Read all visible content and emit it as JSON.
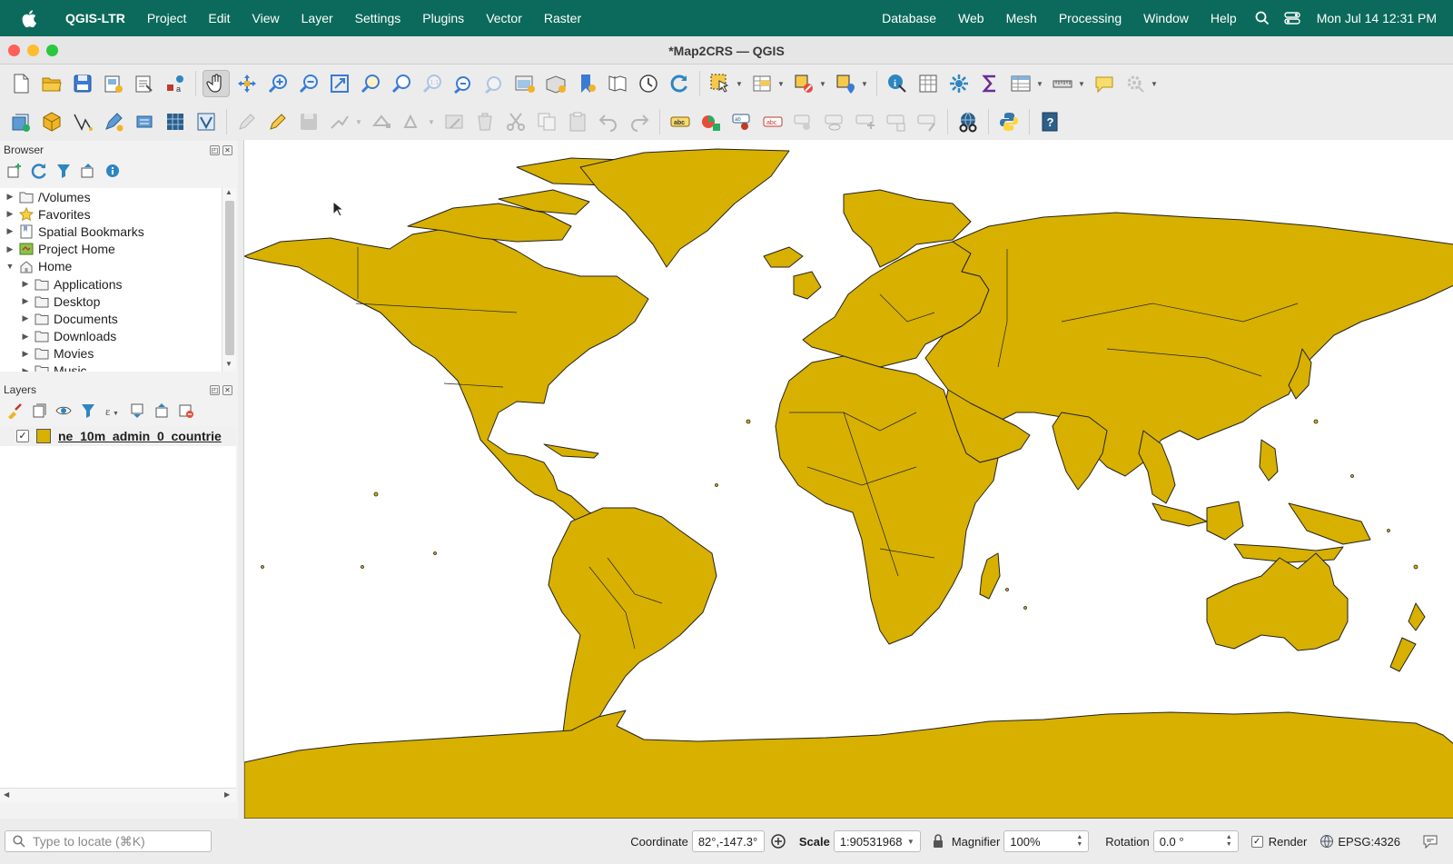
{
  "menubar": {
    "app_name": "QGIS-LTR",
    "left_items": [
      "Project",
      "Edit",
      "View",
      "Layer",
      "Settings",
      "Plugins",
      "Vector",
      "Raster"
    ],
    "right_items": [
      "Database",
      "Web",
      "Mesh",
      "Processing",
      "Window",
      "Help"
    ],
    "clock": "Mon Jul 14  12:31 PM"
  },
  "window": {
    "title": "*Map2CRS — QGIS"
  },
  "browser": {
    "title": "Browser",
    "items": [
      {
        "label": "/Volumes",
        "icon": "folder-icon",
        "indent": 0,
        "expanded": false
      },
      {
        "label": "Favorites",
        "icon": "star-icon",
        "indent": 0,
        "expanded": false
      },
      {
        "label": "Spatial Bookmarks",
        "icon": "bookmark-icon",
        "indent": 0,
        "expanded": false
      },
      {
        "label": "Project Home",
        "icon": "project-home-icon",
        "indent": 0,
        "expanded": false
      },
      {
        "label": "Home",
        "icon": "home-icon",
        "indent": 0,
        "expanded": true
      },
      {
        "label": "Applications",
        "icon": "folder-icon",
        "indent": 1,
        "expanded": false
      },
      {
        "label": "Desktop",
        "icon": "folder-icon",
        "indent": 1,
        "expanded": false
      },
      {
        "label": "Documents",
        "icon": "folder-icon",
        "indent": 1,
        "expanded": false
      },
      {
        "label": "Downloads",
        "icon": "folder-icon",
        "indent": 1,
        "expanded": false
      },
      {
        "label": "Movies",
        "icon": "folder-icon",
        "indent": 1,
        "expanded": false
      },
      {
        "label": "Music",
        "icon": "folder-icon",
        "indent": 1,
        "expanded": false
      }
    ]
  },
  "layers": {
    "title": "Layers",
    "items": [
      {
        "name": "ne_10m_admin_0_countrie",
        "checked": true,
        "fill_color": "#d7b000"
      }
    ]
  },
  "statusbar": {
    "locator_placeholder": "Type to locate (⌘K)",
    "coordinate_label": "Coordinate",
    "coordinate_value": "82°,-147.3°",
    "scale_label": "Scale",
    "scale_value": "1:90531968",
    "magnifier_label": "Magnifier",
    "magnifier_value": "100%",
    "rotation_label": "Rotation",
    "rotation_value": "0.0 °",
    "render_label": "Render",
    "render_checked": true,
    "crs": "EPSG:4326"
  },
  "colors": {
    "menubar_bg": "#0b6a5b",
    "land_fill": "#d7b000",
    "ocean": "#ffffff"
  }
}
